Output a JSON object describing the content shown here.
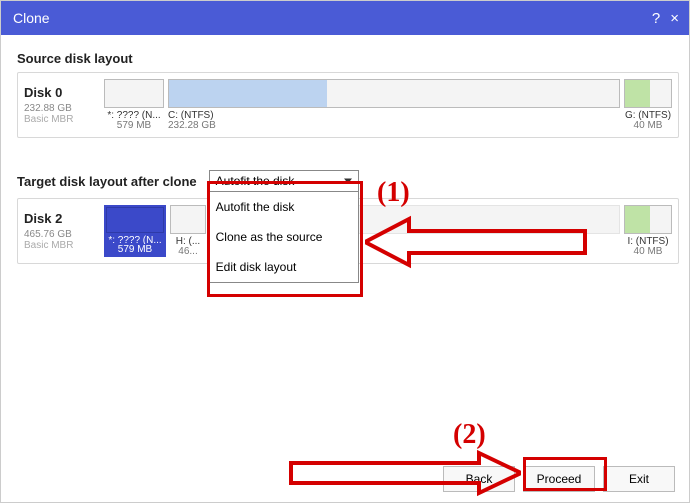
{
  "titlebar": {
    "title": "Clone",
    "help_tooltip": "?",
    "close_tooltip": "×"
  },
  "sections": {
    "source_heading": "Source disk layout",
    "target_heading": "Target disk layout after clone"
  },
  "dropdown": {
    "selected": "Autofit the disk",
    "options": [
      "Autofit the disk",
      "Clone as the source",
      "Edit disk layout"
    ]
  },
  "source_disk": {
    "name": "Disk 0",
    "size": "232.88 GB",
    "type": "Basic MBR",
    "partitions": [
      {
        "label": "*: ???? (N...",
        "size": "579 MB"
      },
      {
        "label": "C: (NTFS)",
        "size": "232.28 GB"
      },
      {
        "label": "G: (NTFS)",
        "size": "40 MB"
      }
    ]
  },
  "target_disk": {
    "name": "Disk 2",
    "size": "465.76 GB",
    "type": "Basic MBR",
    "partitions": [
      {
        "label": "*: ???? (N...",
        "size": "579 MB"
      },
      {
        "label": "H: (...",
        "size": "46..."
      },
      {
        "label": "I: (NTFS)",
        "size": "40 MB"
      }
    ]
  },
  "footer": {
    "back": "Back",
    "proceed": "Proceed",
    "exit": "Exit"
  },
  "annotations": {
    "num1": "(1)",
    "num2": "(2)"
  }
}
